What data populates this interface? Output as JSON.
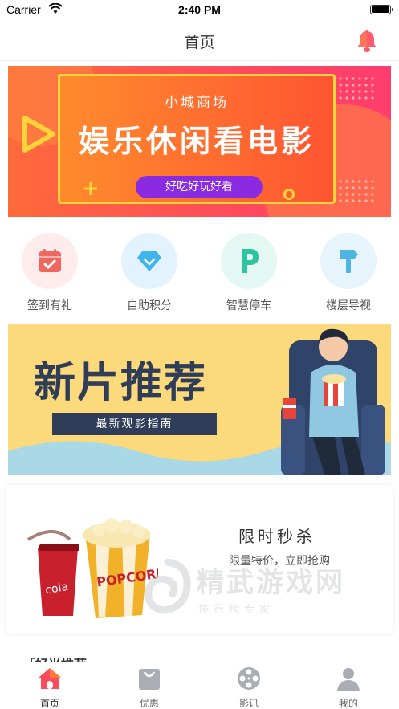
{
  "status_bar": {
    "carrier": "Carrier",
    "time": "2:40 PM"
  },
  "nav": {
    "title": "首页",
    "right_icon": "bell-icon"
  },
  "banner": {
    "subtitle": "小城商场",
    "headline": "娱乐休闲看电影",
    "button": "好吃好玩好看"
  },
  "menu": [
    {
      "label": "签到有礼",
      "icon": "calendar-check-icon",
      "bg": "#fdeceb",
      "color": "#f0675f"
    },
    {
      "label": "自助积分",
      "icon": "diamond-icon",
      "bg": "#e3f3fd",
      "color": "#3fb5ee"
    },
    {
      "label": "智慧停车",
      "icon": "parking-icon",
      "bg": "#e3f8f2",
      "color": "#2ec4a0"
    },
    {
      "label": "楼层导视",
      "icon": "signpost-icon",
      "bg": "#e6f4fb",
      "color": "#4fb4e0"
    }
  ],
  "movie_banner": {
    "headline": "新片推荐",
    "tagline": "最新观影指南"
  },
  "flash_sale": {
    "title": "限时秒杀",
    "subtitle": "限量特价，立即抢购"
  },
  "watermark": {
    "brand": "精武游戏网",
    "slogan": "排行榜专家"
  },
  "next_section": {
    "title": "「好光推荐"
  },
  "tabs": [
    {
      "label": "首页",
      "icon": "home-icon",
      "active": true
    },
    {
      "label": "优惠",
      "icon": "shopping-bag-icon",
      "active": false
    },
    {
      "label": "影讯",
      "icon": "film-reel-icon",
      "active": false
    },
    {
      "label": "我的",
      "icon": "user-icon",
      "active": false
    }
  ],
  "colors": {
    "accent": "#ff4a5c",
    "banner_pill": "#8a2be2",
    "movie_bg": "#fcd97a",
    "movie_text": "#2f3d58"
  }
}
